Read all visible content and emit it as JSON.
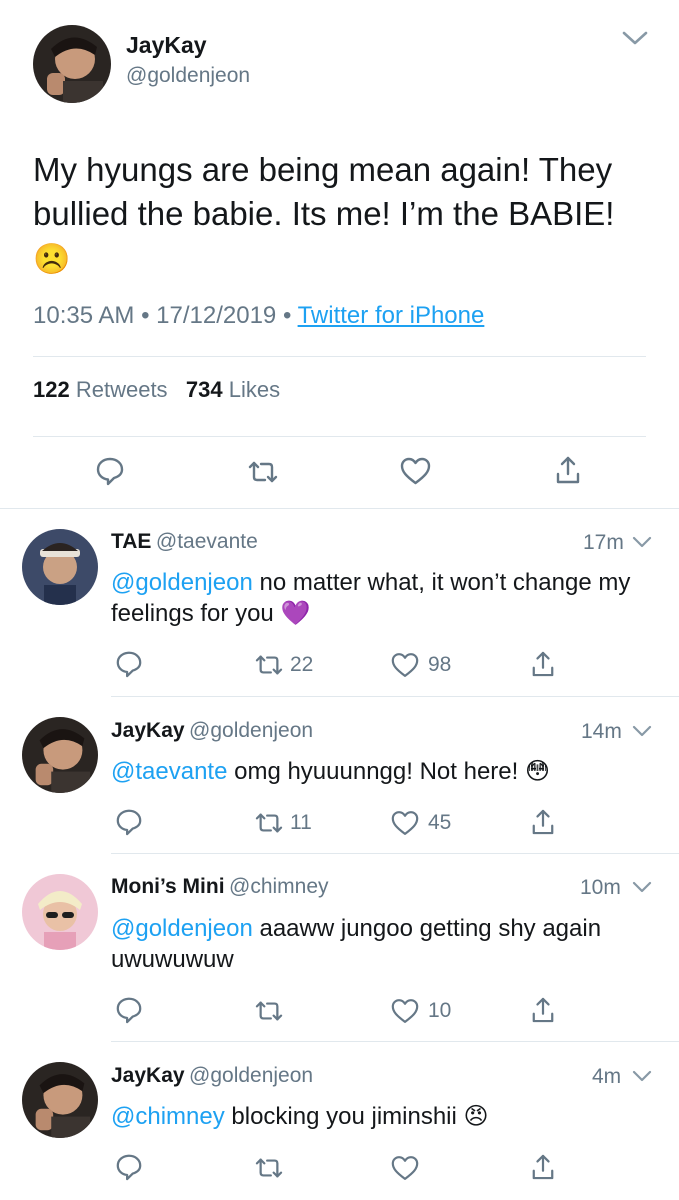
{
  "main_tweet": {
    "name": "JayKay",
    "handle": "@goldenjeon",
    "text": "My hyungs are being mean again! They bullied the babie. Its me! I’m the BABIE!",
    "emoji": "☹️",
    "time": "10:35 AM",
    "date": "17/12/2019",
    "source": "Twitter for iPhone",
    "retweets_count": "122",
    "retweets_label": "Retweets",
    "likes_count": "734",
    "likes_label": "Likes"
  },
  "replies": [
    {
      "name": "TAE",
      "handle": "@taevante",
      "time": "17m",
      "mention": "@goldenjeon",
      "text": " no matter what, it won’t change my feelings for you",
      "emoji": "💜",
      "retweets": "22",
      "likes": "98"
    },
    {
      "name": "JayKay",
      "handle": "@goldenjeon",
      "time": "14m",
      "mention": "@taevante",
      "text": " omg hyuuunngg! Not here!",
      "emoji": "😳",
      "retweets": "11",
      "likes": "45"
    },
    {
      "name": "Moni’s Mini",
      "handle": "@chimney",
      "time": "10m",
      "mention": "@goldenjeon",
      "text": " aaaww jungoo getting shy again uwuwuwuw",
      "emoji": "",
      "retweets": "",
      "likes": "10"
    },
    {
      "name": "JayKay",
      "handle": "@goldenjeon",
      "time": "4m",
      "mention": "@chimney",
      "text": " blocking you jiminshii",
      "emoji": "😠",
      "retweets": "",
      "likes": ""
    }
  ],
  "colors": {
    "link": "#1da1f2",
    "muted": "#657786",
    "text": "#14171a",
    "divider": "#e1e8ed"
  }
}
